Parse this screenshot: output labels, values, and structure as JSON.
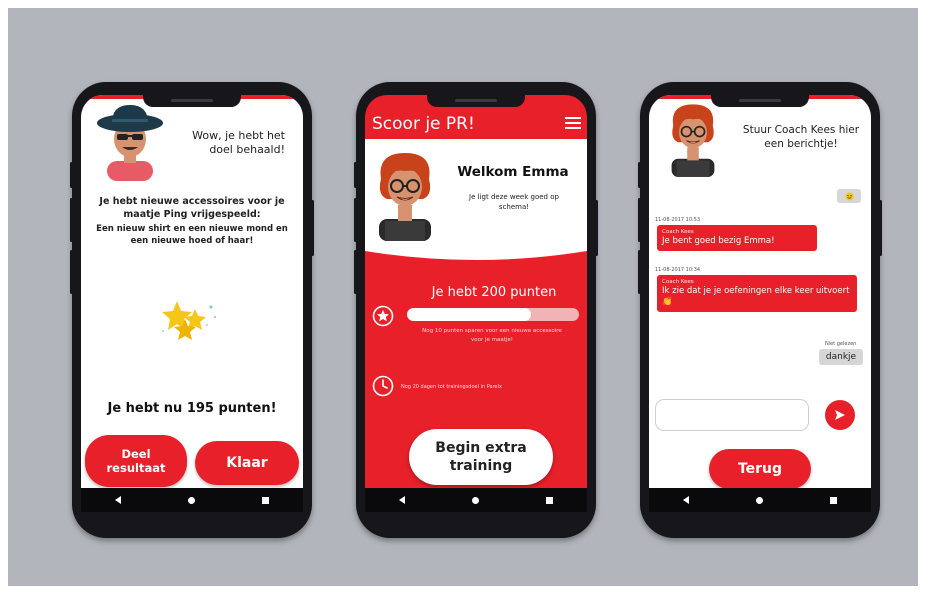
{
  "screen1": {
    "header_text": "Wow, je hebt het doel behaald!",
    "unlock_text": "Je hebt nieuwe accessoires voor je maatje Ping vrijgespeeld:",
    "items_text": "Een nieuw shirt en een nieuwe mond en een nieuwe hoed of haar!",
    "points_text": "Je hebt nu 195 punten!",
    "share_button": "Deel resultaat",
    "done_button": "Klaar"
  },
  "screen2": {
    "app_title": "Scoor je PR!",
    "welcome": "Welkom Emma",
    "subtitle": "Je ligt deze week goed op schema!",
    "points_text": "Je hebt 200 punten",
    "progress": 0.72,
    "progress_note": "Nog 10 punten sparen voor een nieuwe accessoire voor je maatje!",
    "deadline_note": "Nog 20 dagen tot trainingsdoel in Parelx",
    "extra_button": "Begin extra training"
  },
  "screen3": {
    "header_text": "Stuur Coach Kees hier een berichtje!",
    "messages": [
      {
        "stamp": "11-08-2017 10:53",
        "sender": "Coach Kees",
        "text": "Je bent goed bezig Emma!"
      },
      {
        "stamp": "11-08-2017 10:34",
        "sender": "Coach Kees",
        "text": "Ik zie dat je je oefeningen elke keer uitvoert 👏"
      }
    ],
    "read_label": "Niet gelezen",
    "reply": "dankje",
    "send_label": "Verstuur",
    "back_button": "Terug"
  },
  "colors": {
    "accent": "#e8202a",
    "background": "#b3b5bd"
  }
}
